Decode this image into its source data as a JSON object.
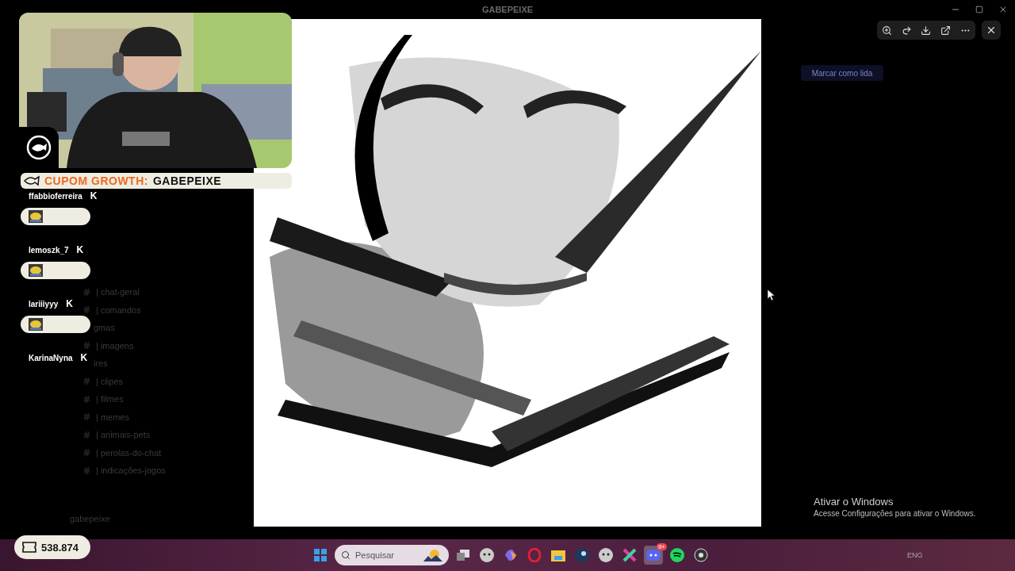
{
  "window": {
    "title": "GABEPEIXE"
  },
  "discord": {
    "channels": [
      {
        "name": "| chat-geral",
        "kind": "full"
      },
      {
        "name": "| comandos",
        "kind": "full"
      },
      {
        "name": "gmas",
        "kind": "partial"
      },
      {
        "name": "| imagens",
        "kind": "full"
      },
      {
        "name": "ires",
        "kind": "partial"
      },
      {
        "name": "| clipes",
        "kind": "full"
      },
      {
        "name": "| filmes",
        "kind": "full"
      },
      {
        "name": "| memes",
        "kind": "full"
      },
      {
        "name": "| animais-pets",
        "kind": "full"
      },
      {
        "name": "| perolas-do-chat",
        "kind": "full"
      },
      {
        "name": "| indicações-jogos",
        "kind": "full"
      }
    ],
    "mark_read": "Marcar como lida",
    "user": "gabepeixe"
  },
  "stream_overlay": {
    "coupon": {
      "label": "CUPOM GROWTH:",
      "code": "GABEPEIXE"
    },
    "chat": [
      {
        "user": "ffabbioferreira",
        "badge": "K",
        "emote": true
      },
      {
        "user": "lemoszk_7",
        "badge": "K",
        "emote": true
      },
      {
        "user": "lariiiyyy",
        "badge": "K",
        "emote": true
      },
      {
        "user": "KarinaNyna",
        "badge": "K",
        "emote": false
      }
    ],
    "points": "538.874"
  },
  "activation_notice": {
    "title": "Ativar o Windows",
    "text": "Acesse Configurações para ativar o Windows."
  },
  "taskbar": {
    "search": {
      "placeholder": "Pesquisar"
    },
    "discord_badge": "9+",
    "language": "ENG"
  }
}
